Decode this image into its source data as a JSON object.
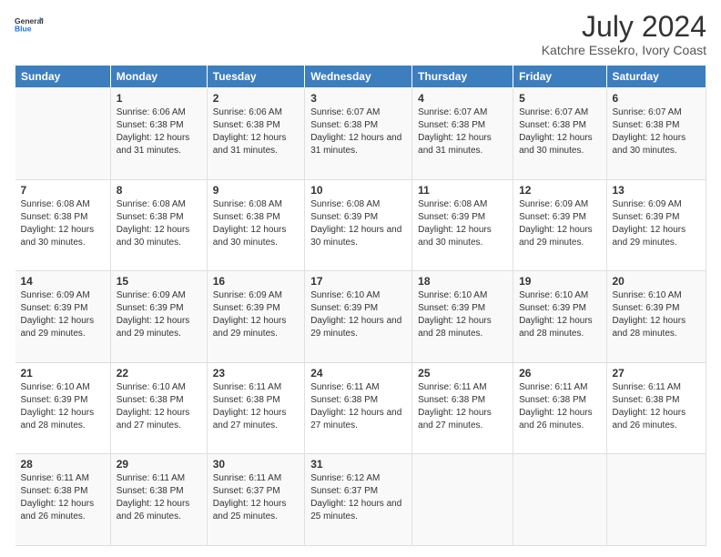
{
  "logo": {
    "line1": "General",
    "line2": "Blue"
  },
  "title": "July 2024",
  "subtitle": "Katchre Essekro, Ivory Coast",
  "days": [
    "Sunday",
    "Monday",
    "Tuesday",
    "Wednesday",
    "Thursday",
    "Friday",
    "Saturday"
  ],
  "weeks": [
    [
      {
        "num": "",
        "sunrise": "",
        "sunset": "",
        "daylight": ""
      },
      {
        "num": "1",
        "sunrise": "Sunrise: 6:06 AM",
        "sunset": "Sunset: 6:38 PM",
        "daylight": "Daylight: 12 hours and 31 minutes."
      },
      {
        "num": "2",
        "sunrise": "Sunrise: 6:06 AM",
        "sunset": "Sunset: 6:38 PM",
        "daylight": "Daylight: 12 hours and 31 minutes."
      },
      {
        "num": "3",
        "sunrise": "Sunrise: 6:07 AM",
        "sunset": "Sunset: 6:38 PM",
        "daylight": "Daylight: 12 hours and 31 minutes."
      },
      {
        "num": "4",
        "sunrise": "Sunrise: 6:07 AM",
        "sunset": "Sunset: 6:38 PM",
        "daylight": "Daylight: 12 hours and 31 minutes."
      },
      {
        "num": "5",
        "sunrise": "Sunrise: 6:07 AM",
        "sunset": "Sunset: 6:38 PM",
        "daylight": "Daylight: 12 hours and 30 minutes."
      },
      {
        "num": "6",
        "sunrise": "Sunrise: 6:07 AM",
        "sunset": "Sunset: 6:38 PM",
        "daylight": "Daylight: 12 hours and 30 minutes."
      }
    ],
    [
      {
        "num": "7",
        "sunrise": "Sunrise: 6:08 AM",
        "sunset": "Sunset: 6:38 PM",
        "daylight": "Daylight: 12 hours and 30 minutes."
      },
      {
        "num": "8",
        "sunrise": "Sunrise: 6:08 AM",
        "sunset": "Sunset: 6:38 PM",
        "daylight": "Daylight: 12 hours and 30 minutes."
      },
      {
        "num": "9",
        "sunrise": "Sunrise: 6:08 AM",
        "sunset": "Sunset: 6:38 PM",
        "daylight": "Daylight: 12 hours and 30 minutes."
      },
      {
        "num": "10",
        "sunrise": "Sunrise: 6:08 AM",
        "sunset": "Sunset: 6:39 PM",
        "daylight": "Daylight: 12 hours and 30 minutes."
      },
      {
        "num": "11",
        "sunrise": "Sunrise: 6:08 AM",
        "sunset": "Sunset: 6:39 PM",
        "daylight": "Daylight: 12 hours and 30 minutes."
      },
      {
        "num": "12",
        "sunrise": "Sunrise: 6:09 AM",
        "sunset": "Sunset: 6:39 PM",
        "daylight": "Daylight: 12 hours and 29 minutes."
      },
      {
        "num": "13",
        "sunrise": "Sunrise: 6:09 AM",
        "sunset": "Sunset: 6:39 PM",
        "daylight": "Daylight: 12 hours and 29 minutes."
      }
    ],
    [
      {
        "num": "14",
        "sunrise": "Sunrise: 6:09 AM",
        "sunset": "Sunset: 6:39 PM",
        "daylight": "Daylight: 12 hours and 29 minutes."
      },
      {
        "num": "15",
        "sunrise": "Sunrise: 6:09 AM",
        "sunset": "Sunset: 6:39 PM",
        "daylight": "Daylight: 12 hours and 29 minutes."
      },
      {
        "num": "16",
        "sunrise": "Sunrise: 6:09 AM",
        "sunset": "Sunset: 6:39 PM",
        "daylight": "Daylight: 12 hours and 29 minutes."
      },
      {
        "num": "17",
        "sunrise": "Sunrise: 6:10 AM",
        "sunset": "Sunset: 6:39 PM",
        "daylight": "Daylight: 12 hours and 29 minutes."
      },
      {
        "num": "18",
        "sunrise": "Sunrise: 6:10 AM",
        "sunset": "Sunset: 6:39 PM",
        "daylight": "Daylight: 12 hours and 28 minutes."
      },
      {
        "num": "19",
        "sunrise": "Sunrise: 6:10 AM",
        "sunset": "Sunset: 6:39 PM",
        "daylight": "Daylight: 12 hours and 28 minutes."
      },
      {
        "num": "20",
        "sunrise": "Sunrise: 6:10 AM",
        "sunset": "Sunset: 6:39 PM",
        "daylight": "Daylight: 12 hours and 28 minutes."
      }
    ],
    [
      {
        "num": "21",
        "sunrise": "Sunrise: 6:10 AM",
        "sunset": "Sunset: 6:39 PM",
        "daylight": "Daylight: 12 hours and 28 minutes."
      },
      {
        "num": "22",
        "sunrise": "Sunrise: 6:10 AM",
        "sunset": "Sunset: 6:38 PM",
        "daylight": "Daylight: 12 hours and 27 minutes."
      },
      {
        "num": "23",
        "sunrise": "Sunrise: 6:11 AM",
        "sunset": "Sunset: 6:38 PM",
        "daylight": "Daylight: 12 hours and 27 minutes."
      },
      {
        "num": "24",
        "sunrise": "Sunrise: 6:11 AM",
        "sunset": "Sunset: 6:38 PM",
        "daylight": "Daylight: 12 hours and 27 minutes."
      },
      {
        "num": "25",
        "sunrise": "Sunrise: 6:11 AM",
        "sunset": "Sunset: 6:38 PM",
        "daylight": "Daylight: 12 hours and 27 minutes."
      },
      {
        "num": "26",
        "sunrise": "Sunrise: 6:11 AM",
        "sunset": "Sunset: 6:38 PM",
        "daylight": "Daylight: 12 hours and 26 minutes."
      },
      {
        "num": "27",
        "sunrise": "Sunrise: 6:11 AM",
        "sunset": "Sunset: 6:38 PM",
        "daylight": "Daylight: 12 hours and 26 minutes."
      }
    ],
    [
      {
        "num": "28",
        "sunrise": "Sunrise: 6:11 AM",
        "sunset": "Sunset: 6:38 PM",
        "daylight": "Daylight: 12 hours and 26 minutes."
      },
      {
        "num": "29",
        "sunrise": "Sunrise: 6:11 AM",
        "sunset": "Sunset: 6:38 PM",
        "daylight": "Daylight: 12 hours and 26 minutes."
      },
      {
        "num": "30",
        "sunrise": "Sunrise: 6:11 AM",
        "sunset": "Sunset: 6:37 PM",
        "daylight": "Daylight: 12 hours and 25 minutes."
      },
      {
        "num": "31",
        "sunrise": "Sunrise: 6:12 AM",
        "sunset": "Sunset: 6:37 PM",
        "daylight": "Daylight: 12 hours and 25 minutes."
      },
      {
        "num": "",
        "sunrise": "",
        "sunset": "",
        "daylight": ""
      },
      {
        "num": "",
        "sunrise": "",
        "sunset": "",
        "daylight": ""
      },
      {
        "num": "",
        "sunrise": "",
        "sunset": "",
        "daylight": ""
      }
    ]
  ]
}
